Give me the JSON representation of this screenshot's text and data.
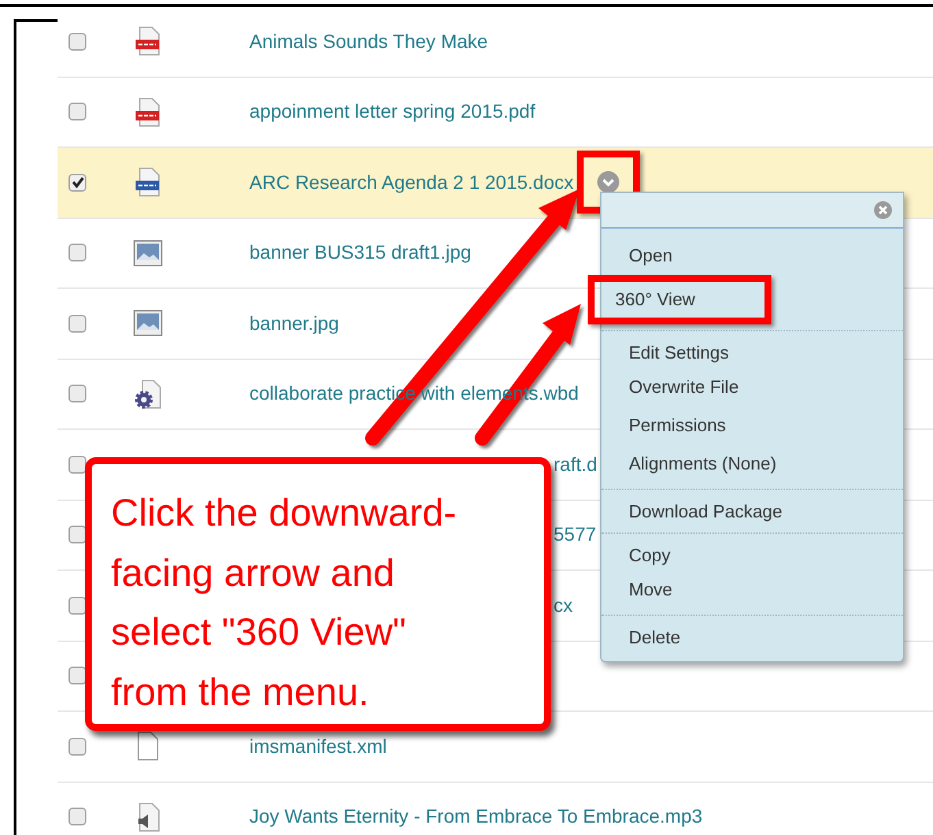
{
  "files": [
    {
      "name": "Animals Sounds They Make",
      "kind": "pdf",
      "checked": false
    },
    {
      "name": "appoinment letter spring 2015.pdf",
      "kind": "pdf",
      "checked": false
    },
    {
      "name": "ARC Research Agenda 2 1 2015.docx",
      "kind": "doc",
      "checked": true,
      "menu_button": true
    },
    {
      "name": "banner BUS315 draft1.jpg",
      "kind": "image",
      "checked": false
    },
    {
      "name": "banner.jpg",
      "kind": "image",
      "checked": false
    },
    {
      "name": "collaborate practice with elements.wbd",
      "kind": "gear",
      "checked": false
    },
    {
      "name": "raft.d",
      "kind": "hidden",
      "checked": false,
      "name_cut": true
    },
    {
      "name": "5577",
      "kind": "hidden",
      "checked": false,
      "name_cut": true
    },
    {
      "name": "cx",
      "kind": "hidden",
      "checked": false,
      "name_cut": true
    },
    {
      "kind": "hidden",
      "checked": false
    },
    {
      "name": "imsmanifest.xml",
      "kind": "blank",
      "checked": false
    },
    {
      "name": "Joy Wants Eternity - From Embrace To Embrace.mp3",
      "kind": "audio",
      "checked": false
    }
  ],
  "context_menu": {
    "items": [
      {
        "label": "Open",
        "divider_before": false,
        "marked": false
      },
      {
        "label": "360° View",
        "divider_before": false,
        "marked": true
      },
      {
        "label": "Edit Settings",
        "divider_before": true,
        "marked": false
      },
      {
        "label": "Overwrite File",
        "divider_before": false,
        "marked": false
      },
      {
        "label": "Permissions",
        "divider_before": false,
        "marked": false
      },
      {
        "label": "Alignments (None)",
        "divider_before": false,
        "marked": false
      },
      {
        "label": "Download Package",
        "divider_before": true,
        "marked": false
      },
      {
        "label": "Copy",
        "divider_before": true,
        "marked": false
      },
      {
        "label": "Move",
        "divider_before": false,
        "marked": false
      },
      {
        "label": "Delete",
        "divider_before": true,
        "marked": false
      }
    ]
  },
  "callout": {
    "text": "Click the downward-facing arrow and select \"360 View\" from the menu."
  }
}
